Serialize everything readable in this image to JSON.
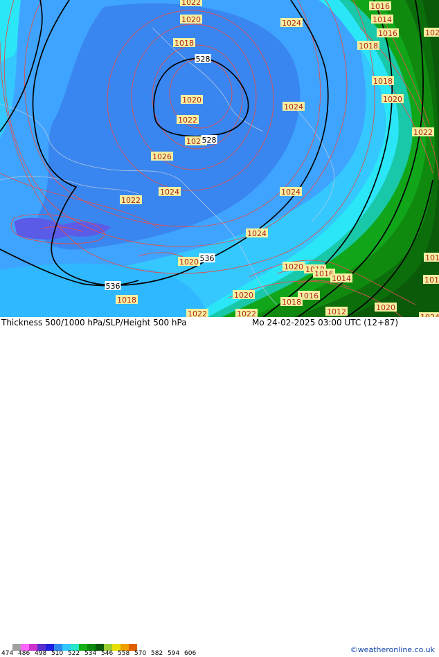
{
  "map": {
    "colors": {
      "t498": "#3a86f0",
      "t504": "#3fa4ff",
      "t510": "#34c8ff",
      "t516": "#2ae6f7",
      "t522": "#18c8a8",
      "t534_light": "#11a61a",
      "t540": "#0f8a0f",
      "t546": "#0b6e0b",
      "t552": "#0a5a0a",
      "slp_contour": "#e05050",
      "height_contour": "#000000",
      "pressure_label_bg": "#f4f0a0"
    },
    "pressure_labels": [
      "1022",
      "1020",
      "1018",
      "1020",
      "1022",
      "1024",
      "1024",
      "1024",
      "1026",
      "1024",
      "1022",
      "1024",
      "1024",
      "1020",
      "1018",
      "1016",
      "1014",
      "1016",
      "1018",
      "1018",
      "1020",
      "1022",
      "1020",
      "1020",
      "1018",
      "1016",
      "1014",
      "1016",
      "1018",
      "1020",
      "1022",
      "1012",
      "1016",
      "1014",
      "1020",
      "1022",
      "1024",
      "1022"
    ],
    "height_labels": [
      "528",
      "528",
      "536",
      "536"
    ]
  },
  "footer": {
    "title": "Thickness 500/1000 hPa/SLP/Height 500 hPa",
    "valid_time": "Mo 24-02-2025 03:00 UTC (12+87)",
    "credit": "©weatheronline.co.uk",
    "legend_values": [
      "474",
      "486",
      "498",
      "510",
      "522",
      "534",
      "546",
      "558",
      "570",
      "582",
      "594",
      "606"
    ],
    "legend_colors": [
      "#a0a0a0",
      "#ff66ff",
      "#cc33cc",
      "#5a2fd0",
      "#2020e0",
      "#2f8af0",
      "#30c8ff",
      "#2ae6c8",
      "#15b015",
      "#0b8a0b",
      "#0a5a0a",
      "#9acd32",
      "#e8e000",
      "#f0a000",
      "#e06000"
    ]
  }
}
